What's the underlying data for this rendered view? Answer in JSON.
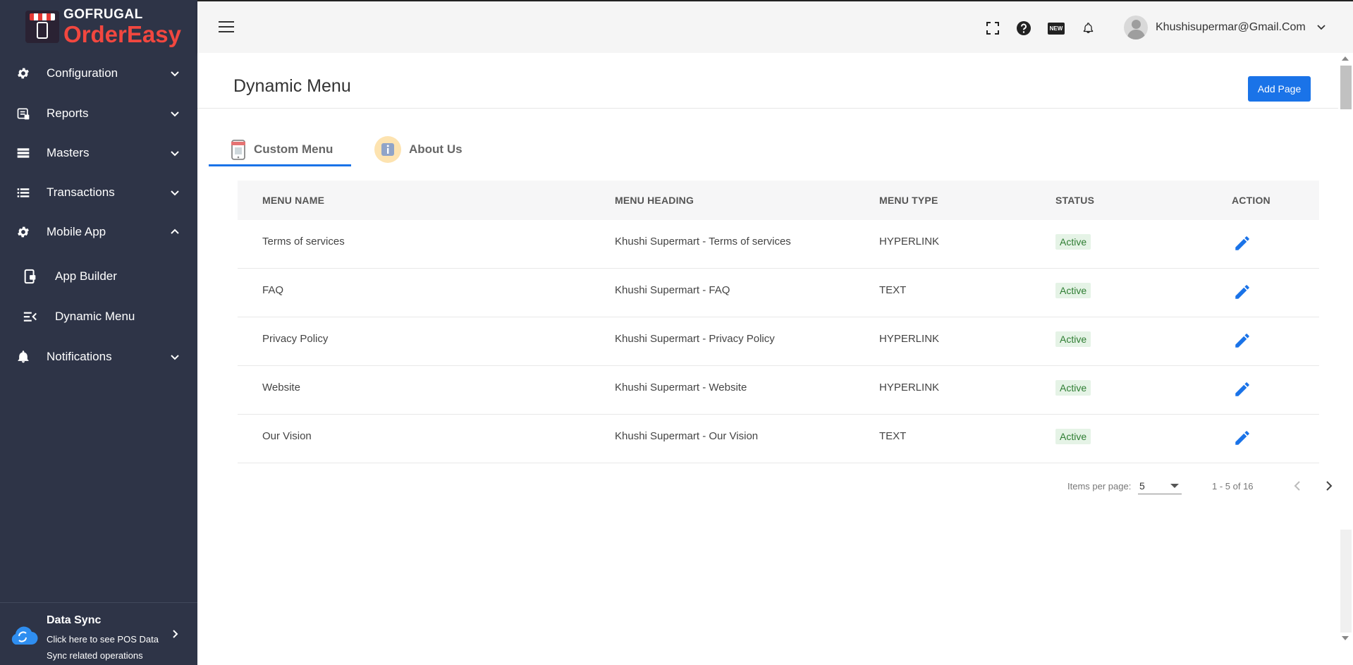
{
  "brand": {
    "line1": "GOFRUGAL",
    "line2": "OrderEasy"
  },
  "sidebar": {
    "items": [
      {
        "label": "Configuration",
        "icon": "gear-icon",
        "expanded": false
      },
      {
        "label": "Reports",
        "icon": "reports-icon",
        "expanded": false
      },
      {
        "label": "Masters",
        "icon": "masters-icon",
        "expanded": false
      },
      {
        "label": "Transactions",
        "icon": "list-icon",
        "expanded": false
      },
      {
        "label": "Mobile App",
        "icon": "gear-icon",
        "expanded": true
      },
      {
        "label": "Notifications",
        "icon": "bell-icon",
        "expanded": false
      }
    ],
    "sub_items": [
      {
        "label": "App Builder",
        "icon": "app-builder-icon"
      },
      {
        "label": "Dynamic Menu",
        "icon": "dynamic-menu-icon"
      }
    ],
    "data_sync": {
      "title": "Data Sync",
      "description": "Click here to see POS Data Sync related operations"
    }
  },
  "header": {
    "user_email": "Khushisupermar@Gmail.Com",
    "new_badge": "NEW"
  },
  "main": {
    "title": "Dynamic Menu",
    "add_button": "Add Page",
    "tabs": [
      {
        "label": "Custom Menu",
        "active": true
      },
      {
        "label": "About Us",
        "active": false
      }
    ],
    "table": {
      "columns": [
        "MENU NAME",
        "MENU HEADING",
        "MENU TYPE",
        "STATUS",
        "ACTION"
      ],
      "rows": [
        {
          "name": "Terms of services",
          "heading": "Khushi Supermart - Terms of services",
          "type": "HYPERLINK",
          "status": "Active"
        },
        {
          "name": "FAQ",
          "heading": "Khushi Supermart - FAQ",
          "type": "TEXT",
          "status": "Active"
        },
        {
          "name": "Privacy Policy",
          "heading": "Khushi Supermart - Privacy Policy",
          "type": "HYPERLINK",
          "status": "Active"
        },
        {
          "name": "Website",
          "heading": "Khushi Supermart - Website",
          "type": "HYPERLINK",
          "status": "Active"
        },
        {
          "name": "Our Vision",
          "heading": "Khushi Supermart - Our Vision",
          "type": "TEXT",
          "status": "Active"
        }
      ]
    },
    "pagination": {
      "items_per_page_label": "Items per page:",
      "items_per_page": "5",
      "range": "1 - 5 of 16"
    }
  },
  "colors": {
    "sidebar_bg": "#2e3447",
    "accent": "#1a73e8",
    "brand_red": "#f2473f",
    "active_badge_text": "#2e7d32",
    "active_badge_bg": "#e5f3e6"
  }
}
